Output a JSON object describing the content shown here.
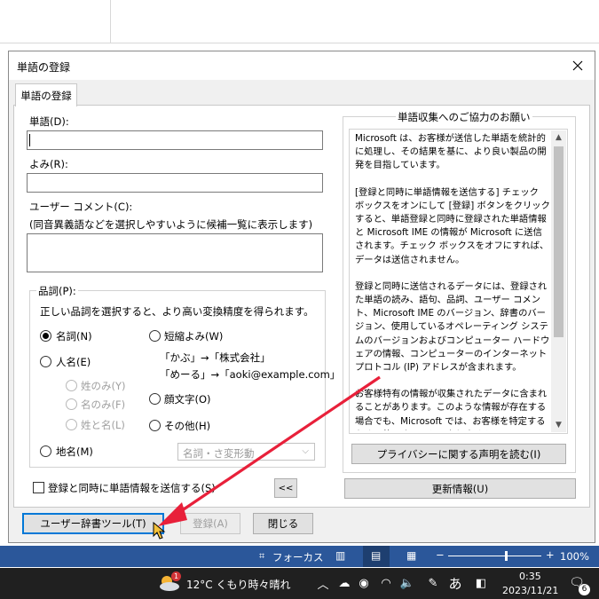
{
  "dialog": {
    "title": "単語の登録",
    "tab": "単語の登録",
    "word_label": "単語(D):",
    "word_value": "",
    "reading_label": "よみ(R):",
    "reading_value": "",
    "comment_label": "ユーザー コメント(C):",
    "comment_hint": "(同音異義語などを選択しやすいように候補一覧に表示します)",
    "comment_value": "",
    "pos_group": {
      "legend": "品詞(P):",
      "description": "正しい品詞を選択すると、より高い変換精度を得られます。",
      "noun": "名詞(N)",
      "abbrev": "短縮よみ(W)",
      "abbrev_example1": "「かぶ」→「株式会社」",
      "abbrev_example2": "「めーる」→「aoki@example.com」",
      "person": "人名(E)",
      "surname": "姓のみ(Y)",
      "givenname": "名のみ(F)",
      "fullname": "姓と名(L)",
      "emoticon": "顔文字(O)",
      "other": "その他(H)",
      "place": "地名(M)",
      "other_select": "名詞・さ変形動"
    },
    "send_checkbox": "登録と同時に単語情報を送信する(S)",
    "collapse_button": "<<",
    "info_group": {
      "legend": "単語収集へのご協力のお願い",
      "paragraphs": [
        "Microsoft は、お客様が送信した単語を統計的に処理し、その結果を基に、より良い製品の開発を目指しています。",
        "[登録と同時に単語情報を送信する] チェック ボックスをオンにして [登録] ボタンをクリックすると、単語登録と同時に登録された単語情報と Microsoft IME の情報が Microsoft に送信されます。チェック ボックスをオフにすれば、データは送信されません。",
        "登録と同時に送信されるデータには、登録された単語の読み、語句、品詞、ユーザー コメント、Microsoft IME のバージョン、辞書のバージョン、使用しているオペレーティング システムのバージョンおよびコンピューター ハードウェアの情報、コンピューターのインターネット プロトコル (IP) アドレスが含まれます。",
        "お客様特有の情報が収集されたデータに含まれることがあります。このような情報が存在する場合でも、Microsoft では、お客様を特定するために使用することはありません。"
      ],
      "privacy_button": "プライバシーに関する声明を読む(I)"
    },
    "update_button": "更新情報(U)",
    "user_dict_button": "ユーザー辞書ツール(T)",
    "register_button": "登録(A)",
    "close_button": "閉じる"
  },
  "statusbar": {
    "focus": "フォーカス",
    "zoom": "100%",
    "zoom_level": 0.62
  },
  "taskbar": {
    "weather_badge": "1",
    "weather": "12°C  くもり時々晴れ",
    "ime_mode": "あ",
    "time": "0:35",
    "date": "2023/11/21",
    "notification_count": "6"
  }
}
